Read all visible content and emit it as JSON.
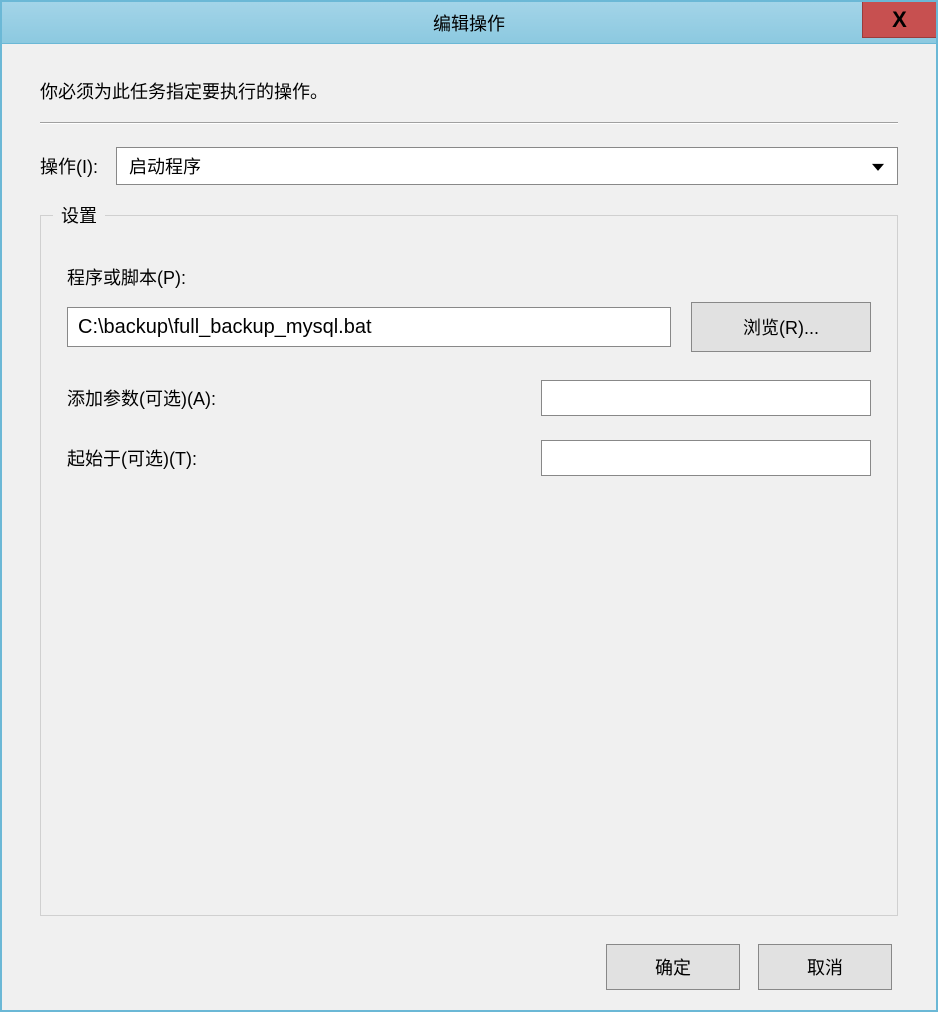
{
  "titlebar": {
    "title": "编辑操作",
    "close_label": "X"
  },
  "instruction": "你必须为此任务指定要执行的操作。",
  "action": {
    "label": "操作(I):",
    "selected": "启动程序"
  },
  "settings": {
    "legend": "设置",
    "program": {
      "label": "程序或脚本(P):",
      "value": "C:\\backup\\full_backup_mysql.bat",
      "browse_label": "浏览(R)..."
    },
    "arguments": {
      "label": "添加参数(可选)(A):",
      "value": ""
    },
    "start_in": {
      "label": "起始于(可选)(T):",
      "value": ""
    }
  },
  "footer": {
    "ok_label": "确定",
    "cancel_label": "取消"
  }
}
